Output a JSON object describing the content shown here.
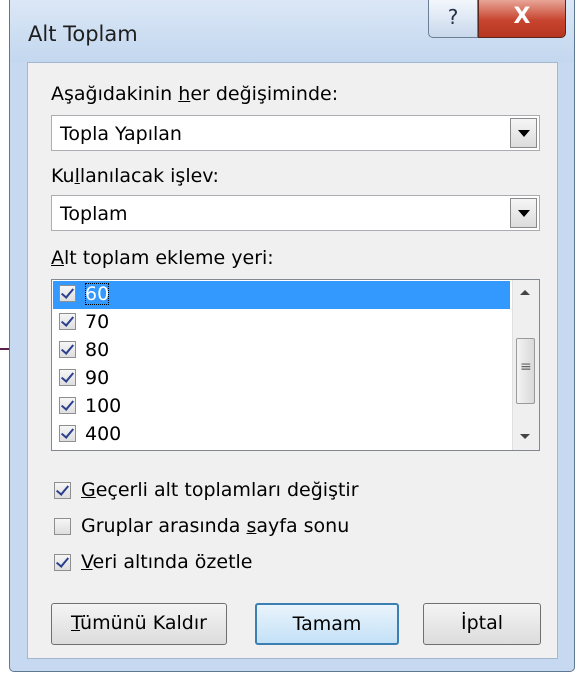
{
  "dialog": {
    "title": "Alt Toplam",
    "help_glyph": "?",
    "close_glyph": "X"
  },
  "change_field": {
    "label_pre": "Aşağıdakinin ",
    "label_u": "h",
    "label_post": "er değişiminde:",
    "value": "Topla Yapılan"
  },
  "function_field": {
    "label_pre": "Ku",
    "label_u": "l",
    "label_post": "lanılacak işlev:",
    "value": "Toplam"
  },
  "subtotal_list": {
    "label_u": "A",
    "label_post": "lt toplam ekleme yeri:",
    "items": [
      {
        "text": "60",
        "checked": true
      },
      {
        "text": "70",
        "checked": true
      },
      {
        "text": "80",
        "checked": true
      },
      {
        "text": "90",
        "checked": true
      },
      {
        "text": "100",
        "checked": true
      },
      {
        "text": "400",
        "checked": true
      }
    ]
  },
  "options": {
    "replace_current": {
      "pre": "",
      "u": "G",
      "post": "eçerli alt toplamları değiştir",
      "checked": true
    },
    "page_break": {
      "pre": "Gruplar arasında ",
      "u": "s",
      "post": "ayfa sonu",
      "checked": false
    },
    "summary_below": {
      "pre": "",
      "u": "V",
      "post": "eri altında özetle",
      "checked": true
    }
  },
  "buttons": {
    "remove_all_u": "T",
    "remove_all_post": "ümünü Kaldır",
    "ok": "Tamam",
    "cancel": "İptal"
  }
}
